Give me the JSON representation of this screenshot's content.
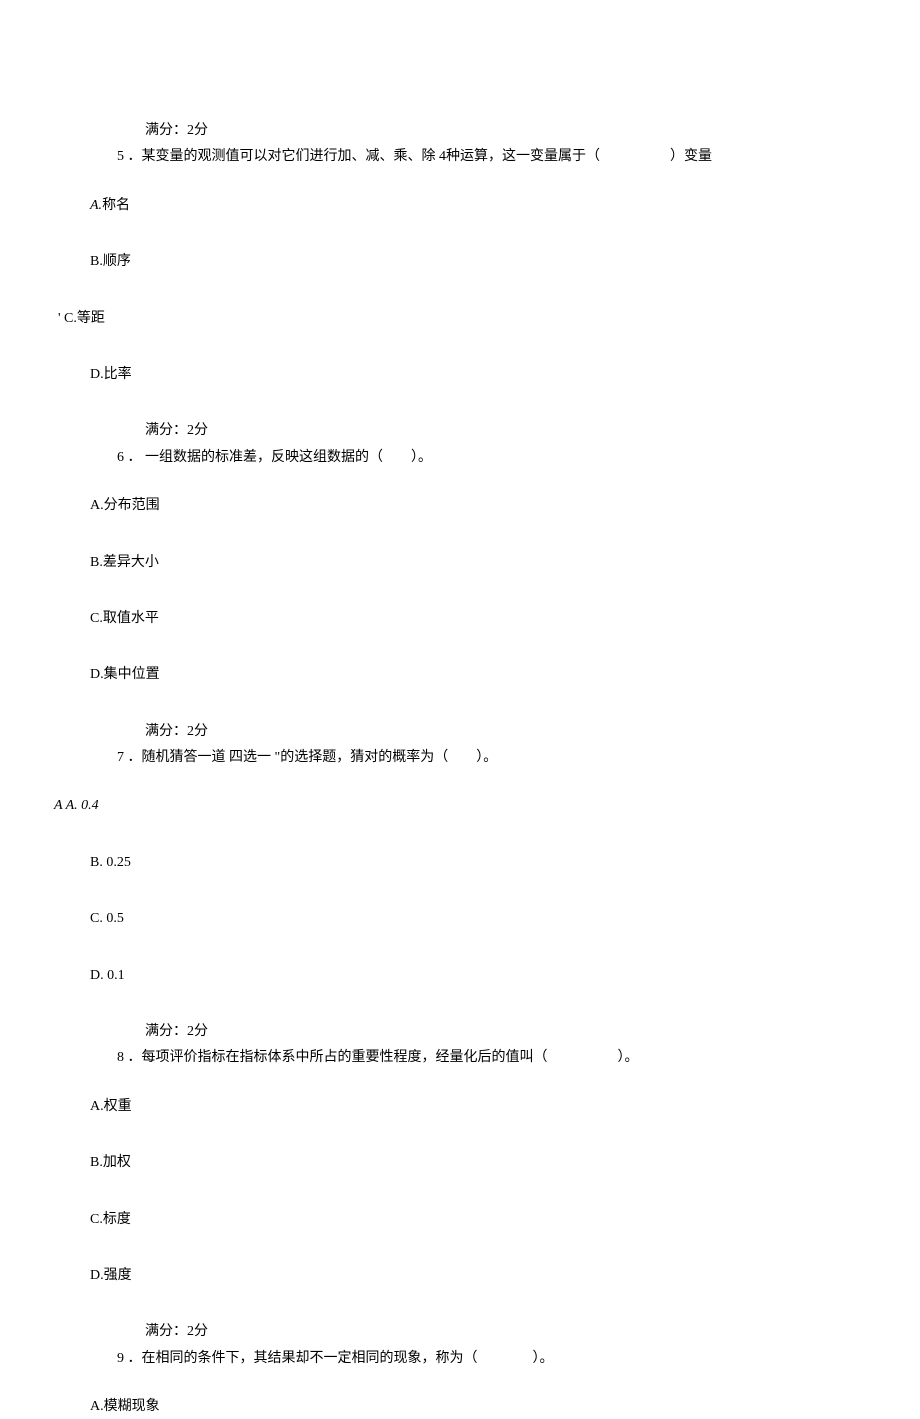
{
  "q5": {
    "score": "满分：2分",
    "number": "5",
    "text_part1": "．某变量的观测值可以对它们进行加、减、乘、除 4种运算，这一变量属于（",
    "text_part2": "）变量",
    "options": {
      "A": "称名",
      "B": "B.顺序",
      "C_prefix": "'",
      "C": "C.等距",
      "D": "D.比率"
    }
  },
  "q6": {
    "score": "满分：2分",
    "number": "6",
    "text": "． 一组数据的标准差，反映这组数据的（　　）。",
    "options": {
      "A": "A.分布范围",
      "B": "B.差异大小",
      "C": "C.取值水平",
      "D": "D.集中位置"
    }
  },
  "q7": {
    "score": "满分：2分",
    "number": "7",
    "text": "．随机猜答一道 四选一 \"的选择题，猜对的概率为（　　）。",
    "options": {
      "A_prefix": "A",
      "A": "A.  0.4",
      "B": "B.  0.25",
      "C": "C.  0.5",
      "D": "D.  0.1"
    }
  },
  "q8": {
    "score": "满分：2分",
    "number": "8",
    "text_part1": "．每项评价指标在指标体系中所占的重要性程度，经量化后的值叫（",
    "text_part2": "）。",
    "options": {
      "A": "A.权重",
      "B": "B.加权",
      "C": "C.标度",
      "D": "D.强度"
    }
  },
  "q9": {
    "score": "满分：2分",
    "number": "9",
    "text_part1": "．在相同的条件下，其结果却不一定相同的现象，称为（",
    "text_part2": "）。",
    "options": {
      "A": "A.模糊现象"
    }
  }
}
